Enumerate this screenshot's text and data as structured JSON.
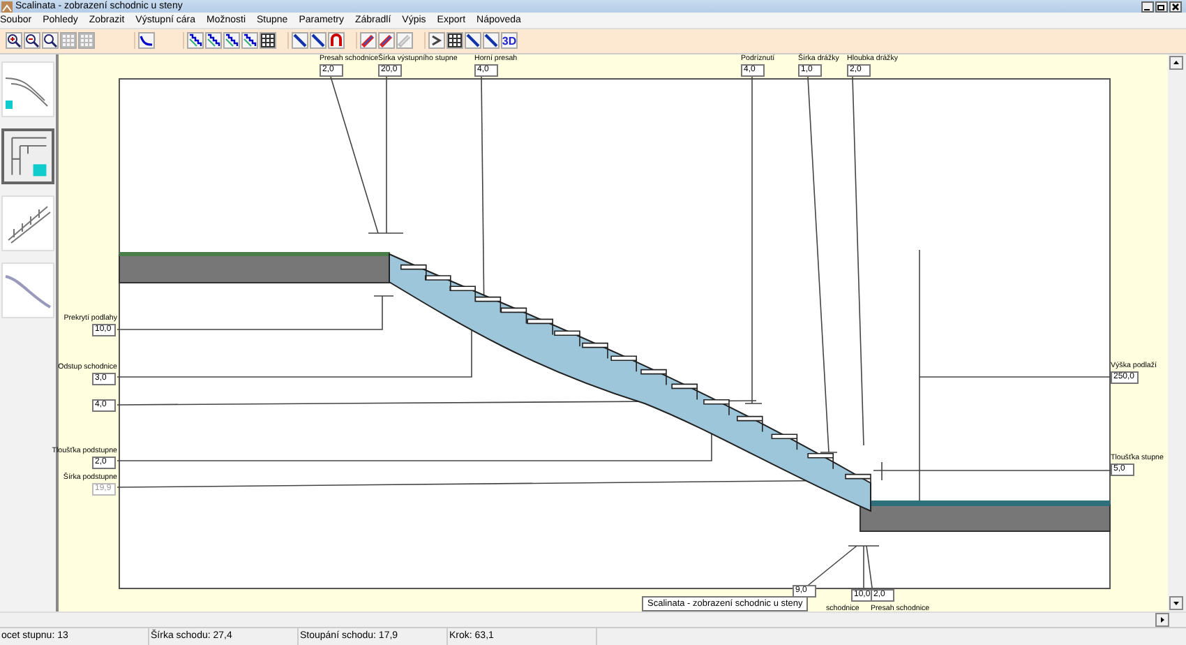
{
  "window": {
    "title": "Scalinata - zobrazení schodnic u steny"
  },
  "menu": [
    "Soubor",
    "Pohledy",
    "Zobrazit",
    "Výstupní cára",
    "Možnosti",
    "Stupne",
    "Parametry",
    "Zábradlí",
    "Výpis",
    "Export",
    "Nápoveda"
  ],
  "toolbar": {
    "view_3d_label": "3D"
  },
  "thumbnails": [
    {
      "selected": false
    },
    {
      "selected": true
    },
    {
      "selected": false
    },
    {
      "selected": false
    }
  ],
  "parameters": [
    {
      "label": "Presah schodnice",
      "value": "2,0",
      "disabled": false
    },
    {
      "label": "Šírka výstupního stupne",
      "value": "20,0",
      "disabled": false
    },
    {
      "label": "Horní presah",
      "value": "4,0",
      "disabled": false
    },
    {
      "label": "Podríznutí",
      "value": "4,0",
      "disabled": false
    },
    {
      "label": "Šírka drážky",
      "value": "1,0",
      "disabled": false
    },
    {
      "label": "Hloubka drážky",
      "value": "2,0",
      "disabled": false
    },
    {
      "label": "Prekrytí podlahy",
      "value": "10,0",
      "disabled": false
    },
    {
      "label": "Odstup schodnice",
      "value": "3,0",
      "disabled": false
    },
    {
      "value": "4,0",
      "disabled": false
    },
    {
      "label": "Tloušťka podstupne",
      "value": "2,0",
      "disabled": false
    },
    {
      "label": "Šírka podstupne",
      "value": "19,9",
      "disabled": true
    },
    {
      "label": "Výška podlaží",
      "value": "250,0",
      "disabled": false
    },
    {
      "label": "Tloušťka stupne",
      "value": "5,0",
      "disabled": false
    },
    {
      "label": "schodnice",
      "value": "9,0",
      "disabled": false
    },
    {
      "value": "10,0",
      "disabled": false
    },
    {
      "label": "Presah schodnice",
      "value": "2,0",
      "disabled": false
    }
  ],
  "tooltip": {
    "text": "Scalinata - zobrazení schodnic u steny"
  },
  "status_bar": [
    "ocet stupnu: 13",
    "Šírka schodu: 27,4",
    "Stoupání schodu: 17,9",
    "Krok: 63,1"
  ]
}
